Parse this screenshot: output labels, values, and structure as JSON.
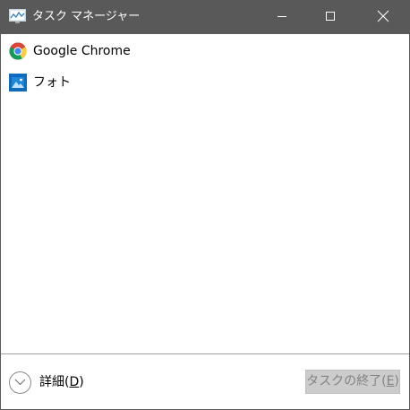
{
  "window": {
    "title": "タスク マネージャー",
    "icon": "task-manager-icon",
    "controls": [
      "minimize-icon",
      "maximize-icon",
      "close-icon"
    ]
  },
  "apps": [
    {
      "label": "Google Chrome",
      "icon": "chrome-icon"
    },
    {
      "label": "フォト",
      "icon": "photos-icon"
    }
  ],
  "footer": {
    "details_label": "詳細",
    "details_accel_open": "(",
    "details_accel": "D",
    "details_accel_close": ")",
    "end_task_label": "タスクの終了",
    "end_task_accel_open": "(",
    "end_task_accel": "E",
    "end_task_accel_close": ")",
    "end_task_enabled": false
  },
  "colors": {
    "titlebar": "#595959",
    "disabled_button_bg": "#cccccc",
    "disabled_button_text": "#838383"
  }
}
